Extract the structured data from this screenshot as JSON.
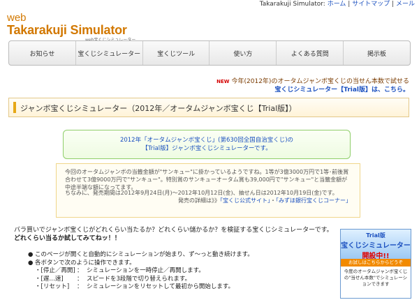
{
  "topbar": {
    "site": "Takarakuji Simulator:",
    "links": [
      "ホーム",
      "サイトマップ",
      "メール"
    ]
  },
  "logo": {
    "line1": "web",
    "line2": "Takarakuji Simulator",
    "line3": "web宝くじシミュレーター"
  },
  "nav": {
    "items": [
      "お知らせ",
      "宝くじシミュレーター",
      "宝くじツール",
      "使い方",
      "よくある質問",
      "掲示板"
    ]
  },
  "news": {
    "badge": "NEW",
    "line1": "今年(2012年)のオータムジャンボ宝くじの当せん本数で試せる",
    "line2": "宝くじシミュレーター【Trial版】は、こちら。"
  },
  "title": {
    "text": "ジャンボ宝くじシミュレーター（2012年／オータムジャンボ宝くじ【Trial版】）"
  },
  "greenbox": {
    "line1": "2012年「オータムジャンボ宝くじ」(第630回全国自治宝くじ)の",
    "line2": "【Trial版】ジャンボ宝くじシミュレーターです。"
  },
  "info": {
    "p1": "今回のオータムジャンボの当籤金額が\"サンキュー\"に掛かっているようですね。1等が3億3000万円で1等･前後賞合わせて3億9000万円で\"サンキュー\"。特別賞のサンキューオータム賞も39,000円で\"サンキュー\"と当籤金額が中途半端な額になってます。",
    "p2": "ちなみに、発売期間は2012年9月24日(月)〜2012年10月12日(金)、抽せん日は2012年10月19日(金)です。",
    "p3_prefix": "発売の詳細は》》",
    "link1": "「宝くじ公式サイト」",
    "link2": "「みずほ銀行宝くじコーナー」"
  },
  "intro": {
    "line1": "バラ買いでジャンボ宝くじがどれくらい当たるか？どれくらい儲かるか？を検証する宝くじシミュレーターです。",
    "line2": "どれくらい当るか試してみてねッ！！"
  },
  "bullets": {
    "b1": "このページが開くと自動的にシミュレーションが始まり、ず〜っと動き続けます。",
    "b2": "各ボタンで次のように操作できます。",
    "rows": [
      {
        "k": "・[停止／再開]",
        "v": "シミュレーションを一時停止／再開します。"
      },
      {
        "k": "・[遅…速]",
        "v": "スピードを3段階で切り替えられます。"
      },
      {
        "k": "・[リセット]",
        "v": "シミュレーションをリセットして最初から開始します。"
      }
    ]
  },
  "sidebanner": {
    "top": "Trial版",
    "title": "宝くじシミュレーター",
    "open": "開設中!!",
    "mid": "お試しはこちらからどうぞ",
    "bot": "今度のオータムジャンボ宝くじの\"当せん本数\"でシミュレーションできます"
  }
}
